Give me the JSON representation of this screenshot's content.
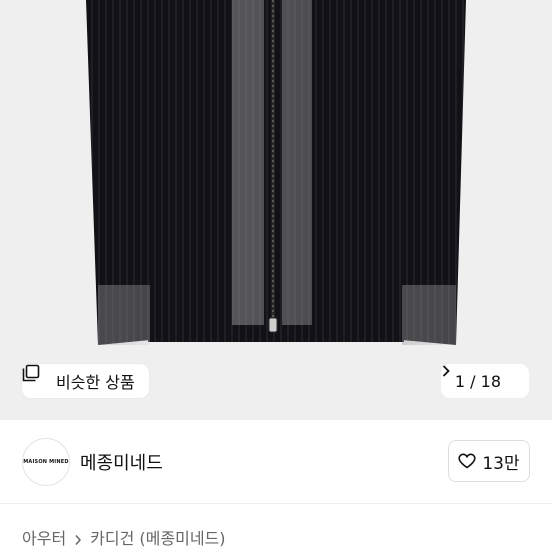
{
  "image_viewer": {
    "similar_button_label": "비슷한 상품",
    "current_page": "1",
    "page_separator": "/",
    "total_pages": "18",
    "icons": {
      "similar": "copy-icon",
      "next": "chevron-right-icon"
    }
  },
  "shop": {
    "logo_text": "MAISON MINED",
    "name": "메종미네드",
    "like_count": "13만",
    "like_icon": "heart-outline-icon"
  },
  "breadcrumb": {
    "items": [
      "아우터",
      "카디건 (메종미네드)"
    ],
    "separator_icon": "chevron-right-icon"
  },
  "colors": {
    "image_background": "#efefef",
    "garment": "#111111",
    "text_primary": "#111111",
    "text_secondary": "#666666",
    "border": "#dedede"
  }
}
